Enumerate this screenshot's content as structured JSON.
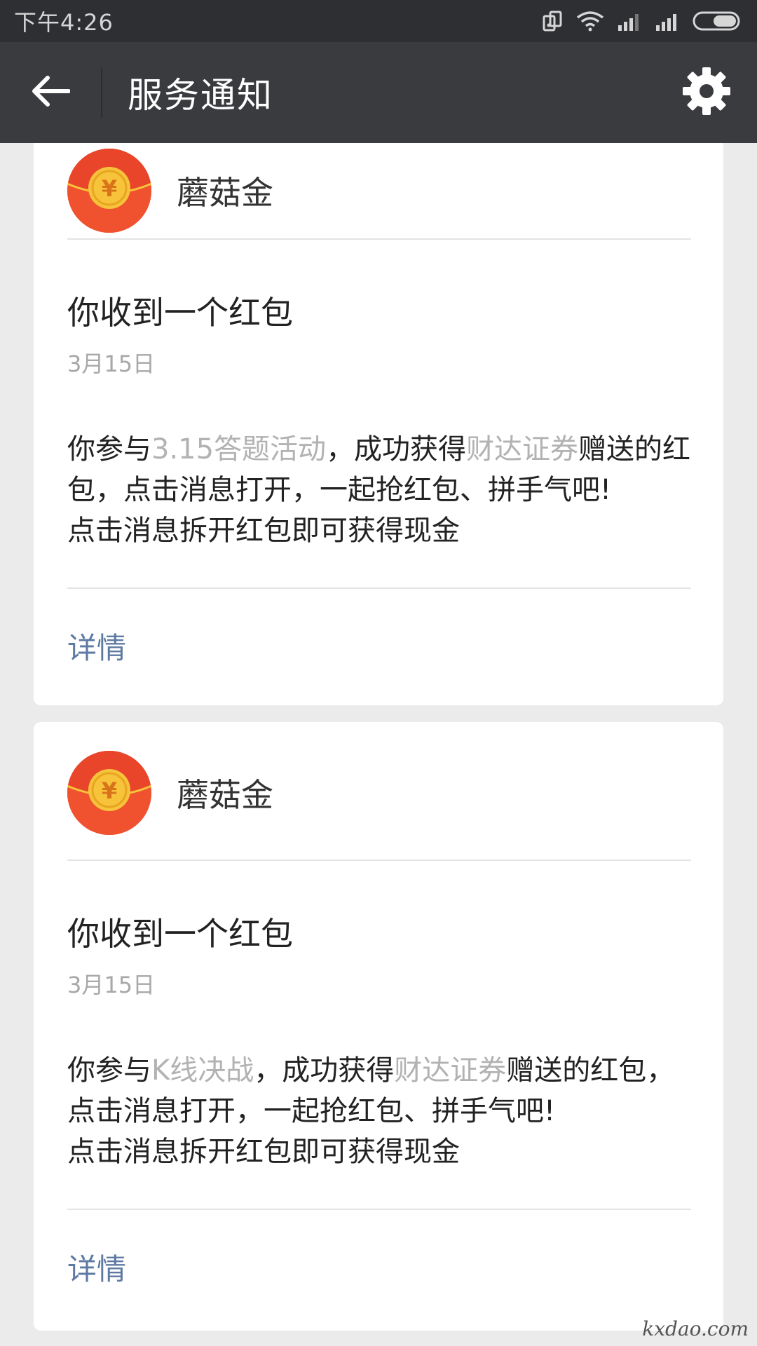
{
  "status_bar": {
    "time": "下午4:26"
  },
  "nav": {
    "title": "服务通知"
  },
  "cards": [
    {
      "sender": "蘑菇金",
      "title": "你收到一个红包",
      "date": "3月15日",
      "body_prefix": "你参与",
      "activity": "3.15答题活动",
      "body_mid": "，成功获得",
      "sponsor": "财达证券",
      "body_rest": "赠送的红包，点击消息打开，一起抢红包、拼手气吧!",
      "body_line3": "点击消息拆开红包即可获得现金",
      "detail": "详情"
    },
    {
      "sender": "蘑菇金",
      "title": "你收到一个红包",
      "date": "3月15日",
      "body_prefix": "你参与",
      "activity": "K线决战",
      "body_mid": "，成功获得",
      "sponsor": "财达证券",
      "body_rest": "赠送的红包，点击消息打开，一起抢红包、拼手气吧!",
      "body_line3": "点击消息拆开红包即可获得现金",
      "detail": "详情"
    }
  ],
  "watermark": "kxdao.com",
  "colors": {
    "nav_bg": "#3a3b3f",
    "status_bg": "#2e2f33",
    "avatar_red": "#f0522f",
    "coin_gold": "#f6c33a",
    "link_blue": "#5d7aa3"
  }
}
